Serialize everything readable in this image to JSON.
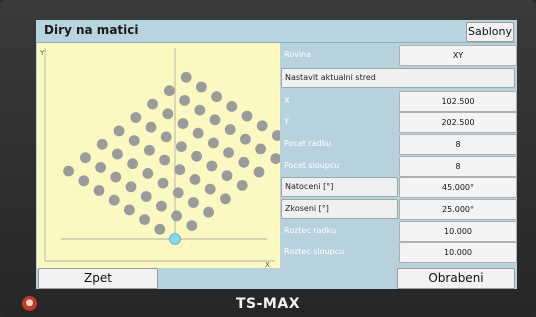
{
  "window": {
    "title": "Diry na matici",
    "templates_label": "Sablony"
  },
  "plot": {
    "y_axis_label": "Y",
    "x_axis_label": "X",
    "grid": {
      "rows": 8,
      "cols": 8,
      "rotation_deg": 45.0,
      "skew_deg": 25.0
    },
    "colors": {
      "hole": "#9b9b9b",
      "origin": "#86dbe8",
      "background": "#fbf8c2"
    }
  },
  "properties": [
    {
      "label": "Rovina",
      "value": "XY",
      "label_is_button": false
    },
    {
      "label": "Nastavit aktualni stred",
      "value": null,
      "label_is_button": true,
      "wide": true
    },
    {
      "label": "X",
      "value": "102.500",
      "label_is_button": false
    },
    {
      "label": "Y",
      "value": "202.500",
      "label_is_button": false
    },
    {
      "label": "Pocet radku",
      "value": "8",
      "label_is_button": false
    },
    {
      "label": "Pocet sloupcu",
      "value": "8",
      "label_is_button": false
    },
    {
      "label": "Natoceni [°]",
      "value": "45.000°",
      "label_is_button": true
    },
    {
      "label": "Zkoseni [°]",
      "value": "25.000°",
      "label_is_button": true
    },
    {
      "label": "Roztec radku",
      "value": "10.000",
      "label_is_button": false
    },
    {
      "label": "Roztec sloupcu",
      "value": "10.000",
      "label_is_button": false
    }
  ],
  "footer": {
    "back_label": "Zpet",
    "machining_label": "Obrabeni"
  },
  "device": {
    "brand": "TS-MAX"
  }
}
